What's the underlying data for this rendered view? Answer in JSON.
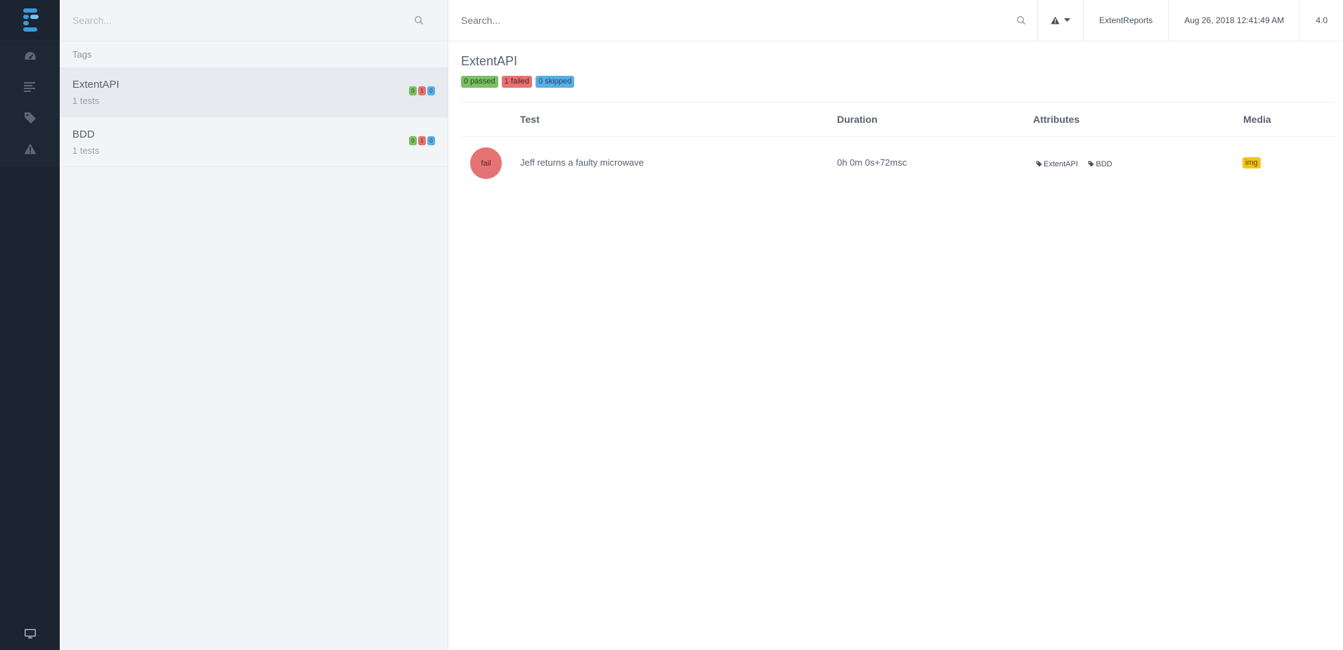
{
  "sidebar": {
    "logo": "extent-logo-icon",
    "nav": [
      {
        "icon": "dashboard-icon"
      },
      {
        "icon": "list-icon"
      },
      {
        "icon": "tag-icon"
      },
      {
        "icon": "warning-icon"
      }
    ],
    "bottom_icon": "monitor-icon"
  },
  "taglist": {
    "search_placeholder": "Search...",
    "section_label": "Tags",
    "items": [
      {
        "name": "ExtentAPI",
        "count": "1 tests",
        "passed": "0",
        "failed": "1",
        "skipped": "0",
        "active": true
      },
      {
        "name": "BDD",
        "count": "1 tests",
        "passed": "0",
        "failed": "1",
        "skipped": "0",
        "active": false
      }
    ]
  },
  "header": {
    "search_placeholder": "Search...",
    "brand": "ExtentReports",
    "timestamp": "Aug 26, 2018 12:41:49 AM",
    "version": "4.0"
  },
  "main": {
    "title": "ExtentAPI",
    "badges": {
      "passed": "0 passed",
      "failed": "1 failed",
      "skipped": "0 skipped"
    },
    "columns": {
      "test": "Test",
      "duration": "Duration",
      "attributes": "Attributes",
      "media": "Media"
    },
    "rows": [
      {
        "status": "fail",
        "name": "Jeff returns a faulty microwave",
        "duration": "0h 0m 0s+72msc",
        "attributes": [
          "ExtentAPI",
          "BDD"
        ],
        "media": "img"
      }
    ]
  },
  "colors": {
    "rail_bg": "#1b2430",
    "pass": "#7bc062",
    "fail": "#e57373",
    "skip": "#5aaee6",
    "media": "#f5c518",
    "accent": "#3a9ad9"
  }
}
